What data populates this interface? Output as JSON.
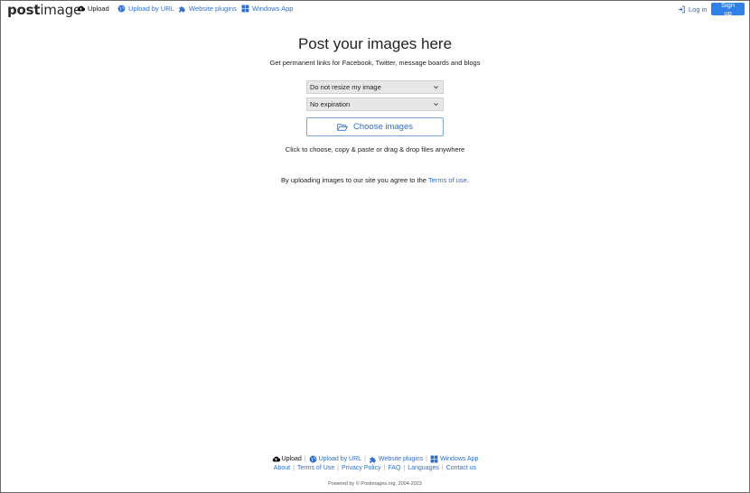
{
  "header": {
    "logo_part1": "post",
    "logo_part2": "image",
    "nav": [
      {
        "label": "Upload",
        "icon": "cloud-upload-icon"
      },
      {
        "label": "Upload by URL",
        "icon": "globe-icon"
      },
      {
        "label": "Website plugins",
        "icon": "puzzle-icon"
      },
      {
        "label": "Windows App",
        "icon": "windows-icon"
      }
    ],
    "login_label": "Log in",
    "signup_label": "Sign up"
  },
  "main": {
    "title": "Post your images here",
    "subtitle": "Get permanent links for Facebook, Twitter, message boards and blogs",
    "resize_select": "Do not resize my image",
    "expiration_select": "No expiration",
    "choose_label": "Choose images",
    "hint": "Click to choose, copy & paste or drag & drop files anywhere",
    "agree_prefix": "By uploading images to our site you agree to the ",
    "agree_link": "Terms of use",
    "agree_suffix": "."
  },
  "footer": {
    "row1": [
      "Upload",
      "Upload by URL",
      "Website plugins",
      "Windows App"
    ],
    "row2": [
      "About",
      "Terms of Use",
      "Privacy Policy",
      "FAQ",
      "Languages",
      "Contact us"
    ],
    "separator": "|",
    "powered": "Powered by © Postimages.org, 2004-2023"
  },
  "colors": {
    "accent": "#2f80e8",
    "link": "#2f6fd0"
  }
}
